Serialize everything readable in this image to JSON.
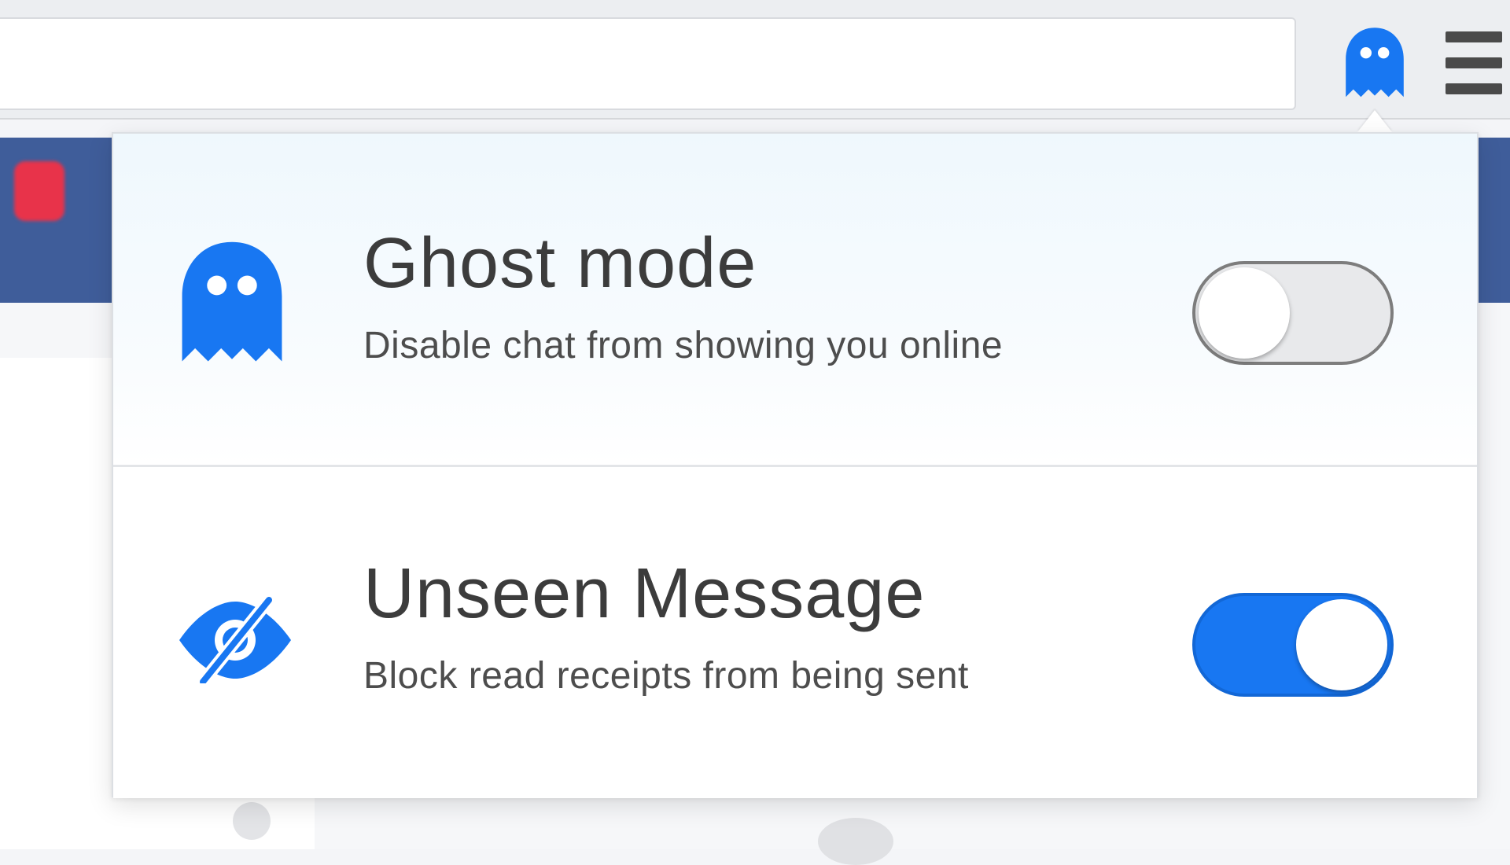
{
  "browser": {
    "extension_icon": "ghost-icon",
    "menu_icon": "hamburger-menu-icon"
  },
  "popup": {
    "options": [
      {
        "icon": "ghost-icon",
        "title": "Ghost mode",
        "description": "Disable chat from showing you online",
        "enabled": false
      },
      {
        "icon": "eye-slash-icon",
        "title": "Unseen Message",
        "description": "Block read receipts from being sent",
        "enabled": true
      }
    ]
  },
  "colors": {
    "accent": "#1877f2",
    "toggle_off": "#e8e9eb",
    "background_header": "#3f5d9a",
    "notification_badge": "#e8334a"
  }
}
